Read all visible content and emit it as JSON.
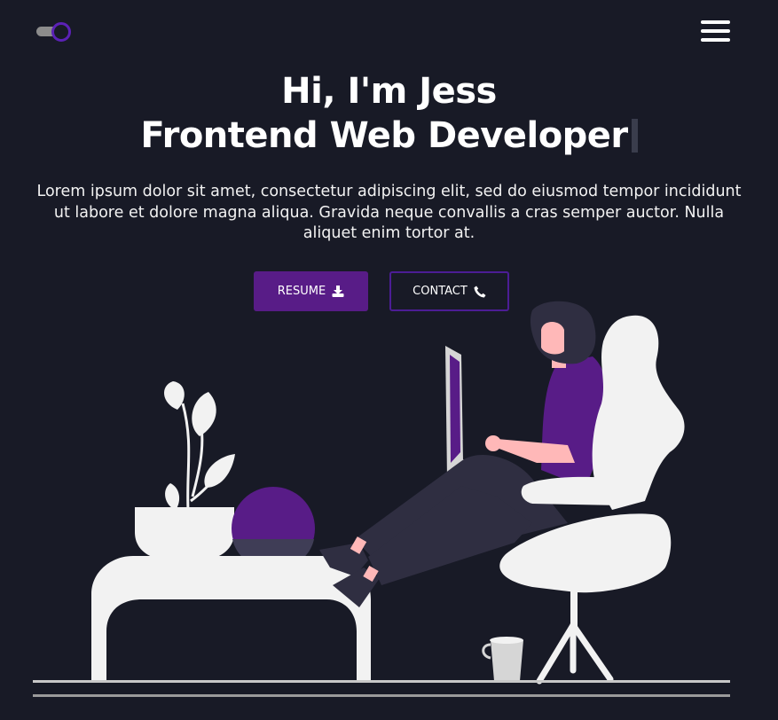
{
  "header": {
    "theme_toggle_icon": "toggle-switch-icon",
    "menu_icon": "hamburger-menu-icon"
  },
  "hero": {
    "greeting": "Hi, I'm Jess",
    "role": "Frontend Web Developer",
    "intro": "Lorem ipsum dolor sit amet, consectetur adipiscing elit, sed do eiusmod tempor incididunt ut labore et dolore magna aliqua. Gravida neque convallis a cras semper auctor. Nulla aliquet enim tortor at."
  },
  "buttons": {
    "resume_label": "RESUME",
    "resume_icon": "download-icon",
    "contact_label": "CONTACT",
    "contact_icon": "phone-icon"
  },
  "colors": {
    "background": "#181a26",
    "accent": "#581c87",
    "accent_border": "#4c1d95",
    "text": "#ffffff",
    "illustration_light": "#f2f2f2",
    "skin": "#ffb8b8"
  }
}
